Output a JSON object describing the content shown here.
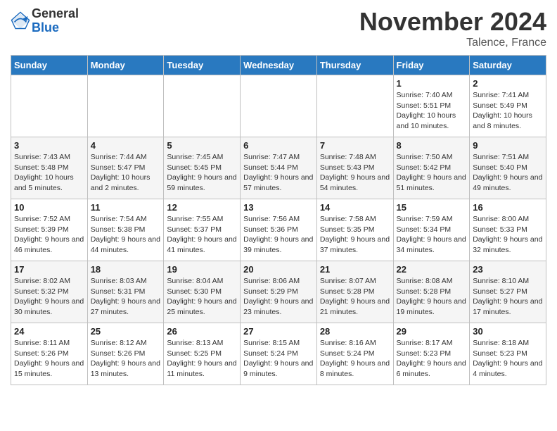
{
  "logo": {
    "general": "General",
    "blue": "Blue"
  },
  "title": "November 2024",
  "location": "Talence, France",
  "days_header": [
    "Sunday",
    "Monday",
    "Tuesday",
    "Wednesday",
    "Thursday",
    "Friday",
    "Saturday"
  ],
  "weeks": [
    [
      {
        "day": "",
        "info": ""
      },
      {
        "day": "",
        "info": ""
      },
      {
        "day": "",
        "info": ""
      },
      {
        "day": "",
        "info": ""
      },
      {
        "day": "",
        "info": ""
      },
      {
        "day": "1",
        "info": "Sunrise: 7:40 AM\nSunset: 5:51 PM\nDaylight: 10 hours and 10 minutes."
      },
      {
        "day": "2",
        "info": "Sunrise: 7:41 AM\nSunset: 5:49 PM\nDaylight: 10 hours and 8 minutes."
      }
    ],
    [
      {
        "day": "3",
        "info": "Sunrise: 7:43 AM\nSunset: 5:48 PM\nDaylight: 10 hours and 5 minutes."
      },
      {
        "day": "4",
        "info": "Sunrise: 7:44 AM\nSunset: 5:47 PM\nDaylight: 10 hours and 2 minutes."
      },
      {
        "day": "5",
        "info": "Sunrise: 7:45 AM\nSunset: 5:45 PM\nDaylight: 9 hours and 59 minutes."
      },
      {
        "day": "6",
        "info": "Sunrise: 7:47 AM\nSunset: 5:44 PM\nDaylight: 9 hours and 57 minutes."
      },
      {
        "day": "7",
        "info": "Sunrise: 7:48 AM\nSunset: 5:43 PM\nDaylight: 9 hours and 54 minutes."
      },
      {
        "day": "8",
        "info": "Sunrise: 7:50 AM\nSunset: 5:42 PM\nDaylight: 9 hours and 51 minutes."
      },
      {
        "day": "9",
        "info": "Sunrise: 7:51 AM\nSunset: 5:40 PM\nDaylight: 9 hours and 49 minutes."
      }
    ],
    [
      {
        "day": "10",
        "info": "Sunrise: 7:52 AM\nSunset: 5:39 PM\nDaylight: 9 hours and 46 minutes."
      },
      {
        "day": "11",
        "info": "Sunrise: 7:54 AM\nSunset: 5:38 PM\nDaylight: 9 hours and 44 minutes."
      },
      {
        "day": "12",
        "info": "Sunrise: 7:55 AM\nSunset: 5:37 PM\nDaylight: 9 hours and 41 minutes."
      },
      {
        "day": "13",
        "info": "Sunrise: 7:56 AM\nSunset: 5:36 PM\nDaylight: 9 hours and 39 minutes."
      },
      {
        "day": "14",
        "info": "Sunrise: 7:58 AM\nSunset: 5:35 PM\nDaylight: 9 hours and 37 minutes."
      },
      {
        "day": "15",
        "info": "Sunrise: 7:59 AM\nSunset: 5:34 PM\nDaylight: 9 hours and 34 minutes."
      },
      {
        "day": "16",
        "info": "Sunrise: 8:00 AM\nSunset: 5:33 PM\nDaylight: 9 hours and 32 minutes."
      }
    ],
    [
      {
        "day": "17",
        "info": "Sunrise: 8:02 AM\nSunset: 5:32 PM\nDaylight: 9 hours and 30 minutes."
      },
      {
        "day": "18",
        "info": "Sunrise: 8:03 AM\nSunset: 5:31 PM\nDaylight: 9 hours and 27 minutes."
      },
      {
        "day": "19",
        "info": "Sunrise: 8:04 AM\nSunset: 5:30 PM\nDaylight: 9 hours and 25 minutes."
      },
      {
        "day": "20",
        "info": "Sunrise: 8:06 AM\nSunset: 5:29 PM\nDaylight: 9 hours and 23 minutes."
      },
      {
        "day": "21",
        "info": "Sunrise: 8:07 AM\nSunset: 5:28 PM\nDaylight: 9 hours and 21 minutes."
      },
      {
        "day": "22",
        "info": "Sunrise: 8:08 AM\nSunset: 5:28 PM\nDaylight: 9 hours and 19 minutes."
      },
      {
        "day": "23",
        "info": "Sunrise: 8:10 AM\nSunset: 5:27 PM\nDaylight: 9 hours and 17 minutes."
      }
    ],
    [
      {
        "day": "24",
        "info": "Sunrise: 8:11 AM\nSunset: 5:26 PM\nDaylight: 9 hours and 15 minutes."
      },
      {
        "day": "25",
        "info": "Sunrise: 8:12 AM\nSunset: 5:26 PM\nDaylight: 9 hours and 13 minutes."
      },
      {
        "day": "26",
        "info": "Sunrise: 8:13 AM\nSunset: 5:25 PM\nDaylight: 9 hours and 11 minutes."
      },
      {
        "day": "27",
        "info": "Sunrise: 8:15 AM\nSunset: 5:24 PM\nDaylight: 9 hours and 9 minutes."
      },
      {
        "day": "28",
        "info": "Sunrise: 8:16 AM\nSunset: 5:24 PM\nDaylight: 9 hours and 8 minutes."
      },
      {
        "day": "29",
        "info": "Sunrise: 8:17 AM\nSunset: 5:23 PM\nDaylight: 9 hours and 6 minutes."
      },
      {
        "day": "30",
        "info": "Sunrise: 8:18 AM\nSunset: 5:23 PM\nDaylight: 9 hours and 4 minutes."
      }
    ]
  ]
}
